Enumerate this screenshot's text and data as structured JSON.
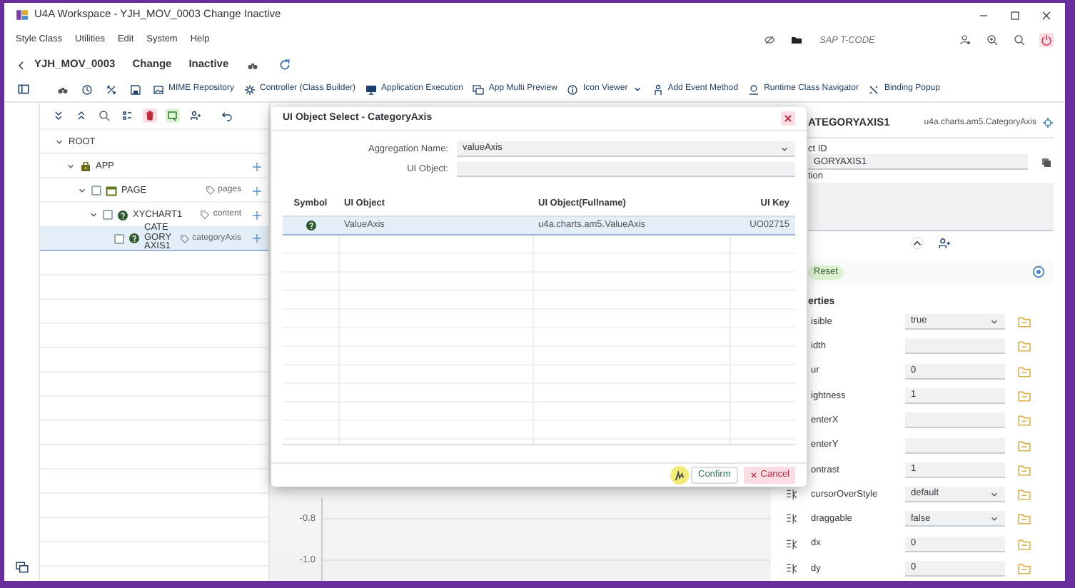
{
  "window": {
    "title": "U4A Workspace - YJH_MOV_0003 Change Inactive"
  },
  "menu": [
    "Style Class",
    "Utilities",
    "Edit",
    "System",
    "Help"
  ],
  "tcode": {
    "placeholder": "SAP T-CODE"
  },
  "header": {
    "app_id": "YJH_MOV_0003",
    "mode": "Change",
    "status": "Inactive"
  },
  "toolbar": [
    {
      "label": "MIME Repository",
      "dropdown": false
    },
    {
      "label": "Controller (Class Builder)",
      "dropdown": false
    },
    {
      "label": "Application Execution",
      "dropdown": false
    },
    {
      "label": "App Multi Preview",
      "dropdown": false
    },
    {
      "label": "Icon Viewer",
      "dropdown": true
    },
    {
      "label": "Add Event Method",
      "dropdown": false
    },
    {
      "label": "Runtime Class Navigator",
      "dropdown": false
    },
    {
      "label": "Binding Popup",
      "dropdown": false
    }
  ],
  "tree": [
    {
      "label": "ROOT",
      "expanded": true,
      "selected": false,
      "add": false,
      "children": [
        {
          "label": "APP",
          "kind": "app",
          "expanded": true,
          "selected": false,
          "add": true,
          "children": [
            {
              "label": "PAGE",
              "kind": "page",
              "checked": false,
              "aggregation": "pages",
              "expanded": true,
              "selected": false,
              "add": true,
              "children": [
                {
                  "label": "XYCHART1",
                  "kind": "ui",
                  "checked": false,
                  "aggregation": "content",
                  "expanded": true,
                  "selected": false,
                  "add": true,
                  "children": [
                    {
                      "label": "CATEGORYAXIS1",
                      "kind": "ui",
                      "checked": false,
                      "aggregation": "categoryAxis",
                      "selected": true,
                      "add": true
                    }
                  ]
                }
              ]
            }
          ]
        }
      ]
    }
  ],
  "chart_axis": [
    "-0.8",
    "-1.0"
  ],
  "dialog": {
    "title": "UI Object Select - CategoryAxis",
    "fields": [
      {
        "label": "Aggregation Name:",
        "kind": "select",
        "value": "valueAxis"
      },
      {
        "label": "UI Object:",
        "kind": "input"
      }
    ],
    "columns": [
      "Symbol",
      "UI Object",
      "UI Object(Fullname)",
      "UI Key"
    ],
    "rows": [
      {
        "ui_object": "ValueAxis",
        "fullname": "u4a.charts.am5.ValueAxis",
        "key": "UO02715",
        "selected": true
      }
    ],
    "buttons": [
      {
        "label": "Confirm",
        "kind": "confirm"
      },
      {
        "label": "Cancel",
        "kind": "cancel"
      }
    ]
  },
  "panel": {
    "title": "ATEGORYAXIS1",
    "class_name": "u4a.charts.am5.CategoryAxis",
    "id_label": "ct ID",
    "id_value": "GORYAXIS1",
    "desc_label": "tion",
    "reset": "Reset",
    "section": "erties",
    "properties": [
      {
        "label": "isible",
        "kind": "select",
        "value": "true",
        "event_icon": false
      },
      {
        "label": "idth",
        "kind": "input",
        "event_icon": false
      },
      {
        "label": "ur",
        "kind": "input",
        "value": "0",
        "event_icon": false
      },
      {
        "label": "ightness",
        "kind": "input",
        "value": "1",
        "event_icon": false
      },
      {
        "label": "enterX",
        "kind": "input",
        "event_icon": false
      },
      {
        "label": "enterY",
        "kind": "input",
        "event_icon": false
      },
      {
        "label": "ontrast",
        "kind": "input",
        "value": "1",
        "event_icon": false
      },
      {
        "label": "cursorOverStyle",
        "kind": "select",
        "value": "default",
        "event_icon": true
      },
      {
        "label": "draggable",
        "kind": "select",
        "value": "false",
        "event_icon": true
      },
      {
        "label": "dx",
        "kind": "input",
        "value": "0",
        "event_icon": true
      },
      {
        "label": "dy",
        "kind": "input",
        "value": "0",
        "event_icon": true
      }
    ]
  }
}
